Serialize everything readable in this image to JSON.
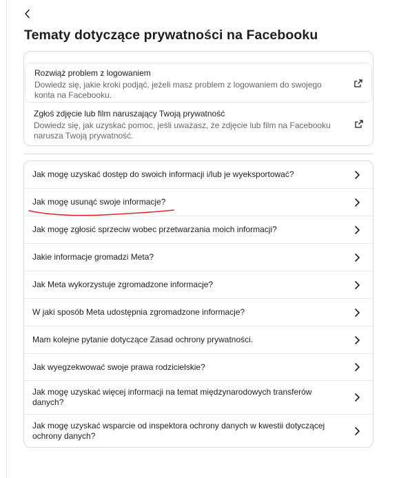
{
  "page": {
    "title": "Tematy dotyczące prywatności na Facebooku"
  },
  "help_links": [
    {
      "title": "Rozwiąż problem z logowaniem",
      "description": "Dowiedz się, jakie kroki podjąć, jeżeli masz problem z logowaniem do swojego konta na Facebooku.",
      "icon": "external-link-icon"
    },
    {
      "title": "Zgłoś zdjęcie lub film naruszający Twoją prywatność",
      "description": "Dowiedz się, jak uzyskać pomoc, jeśli uważasz, że zdjęcie lub film na Facebooku narusza Twoją prywatność.",
      "icon": "external-link-icon"
    }
  ],
  "faq": [
    {
      "q": "Jak mogę uzyskać dostęp do swoich informacji i/lub je wyeksportować?"
    },
    {
      "q": "Jak mogę usunąć swoje informacje?"
    },
    {
      "q": "Jak mogę zgłosić sprzeciw wobec przetwarzania moich informacji?"
    },
    {
      "q": "Jakie informacje gromadzi Meta?"
    },
    {
      "q": "Jak Meta wykorzystuje zgromadzone informacje?"
    },
    {
      "q": "W jaki sposób Meta udostępnia zgromadzone informacje?"
    },
    {
      "q": "Mam kolejne pytanie dotyczące Zasad ochrony prywatności."
    },
    {
      "q": "Jak wyegzekwować swoje prawa rodzicielskie?"
    },
    {
      "q": "Jak mogę uzyskać więcej informacji na temat międzynarodowych transferów danych?"
    },
    {
      "q": "Jak mogę uzyskać wsparcie od inspektora ochrony danych w kwestii dotyczącej ochrony danych?"
    }
  ],
  "icons": {
    "back": "back-arrow-icon",
    "row": "chevron-right-icon"
  },
  "colors": {
    "text": "#1c1e21",
    "secondary_text": "#65676b",
    "border": "#dadde1",
    "annotation": "#e0242b"
  }
}
